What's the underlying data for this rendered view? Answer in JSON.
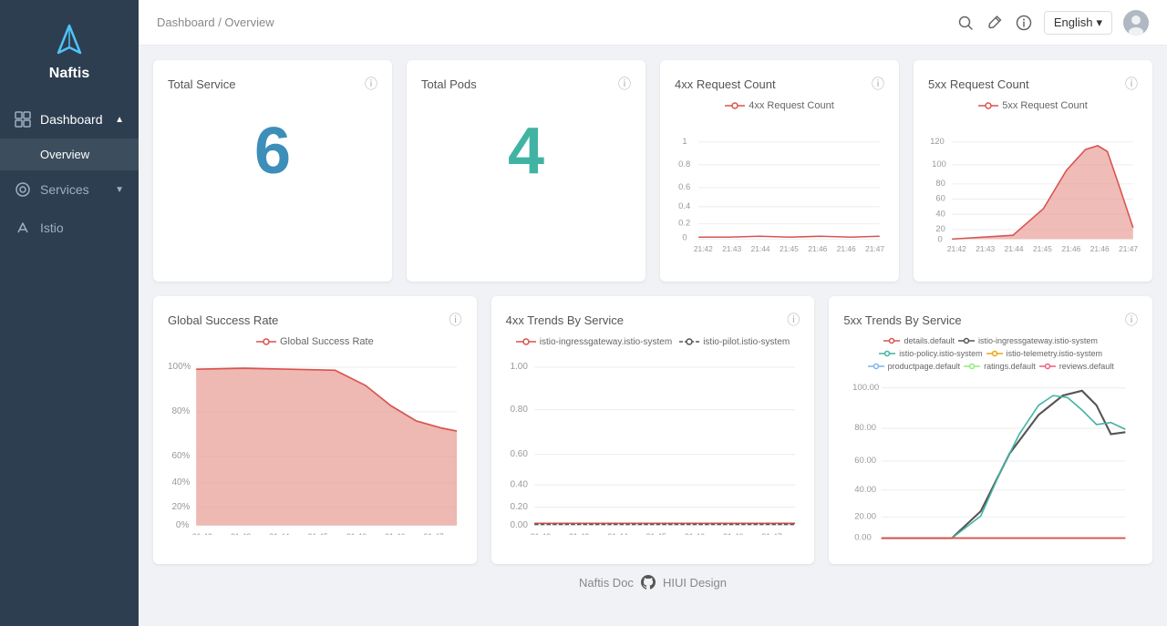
{
  "app": {
    "name": "Naftis",
    "logo_alt": "Naftis Logo"
  },
  "topbar": {
    "breadcrumb": "Dashboard / Overview",
    "language": "English",
    "language_arrow": "▾"
  },
  "sidebar": {
    "items": [
      {
        "id": "dashboard",
        "label": "Dashboard",
        "icon": "dashboard-icon",
        "expandable": true,
        "expanded": true
      },
      {
        "id": "overview",
        "label": "Overview",
        "sub": true
      },
      {
        "id": "services",
        "label": "Services",
        "icon": "services-icon",
        "expandable": true
      },
      {
        "id": "istio",
        "label": "Istio",
        "icon": "istio-icon",
        "expandable": false
      }
    ]
  },
  "cards": {
    "total_service": {
      "title": "Total Service",
      "value": "6",
      "color": "blue"
    },
    "total_pods": {
      "title": "Total Pods",
      "value": "4",
      "color": "teal"
    },
    "req4xx": {
      "title": "4xx Request Count",
      "legend": "4xx Request Count"
    },
    "req5xx": {
      "title": "5xx Request Count",
      "legend": "5xx Request Count"
    }
  },
  "bottom_charts": {
    "global_success": {
      "title": "Global Success Rate",
      "legend": "Global Success Rate"
    },
    "trends4xx": {
      "title": "4xx Trends By Service",
      "legends": [
        "istio-ingressgateway.istio-system",
        "istio-pilot.istio-system"
      ]
    },
    "trends5xx": {
      "title": "5xx Trends By Service",
      "legends": [
        "details.default",
        "istio-ingressgateway.istio-system",
        "istio-policy.istio-system",
        "istio-telemetry.istio-system",
        "productpage.default",
        "ratings.default",
        "reviews.default"
      ]
    }
  },
  "x_axis_labels": [
    "21:42",
    "21:43",
    "21:44",
    "21:45",
    "21:46",
    "21:46",
    "21:47"
  ],
  "footer": {
    "text1": "Naftis Doc",
    "github_icon": "github-icon",
    "text2": "HIUI Design"
  }
}
